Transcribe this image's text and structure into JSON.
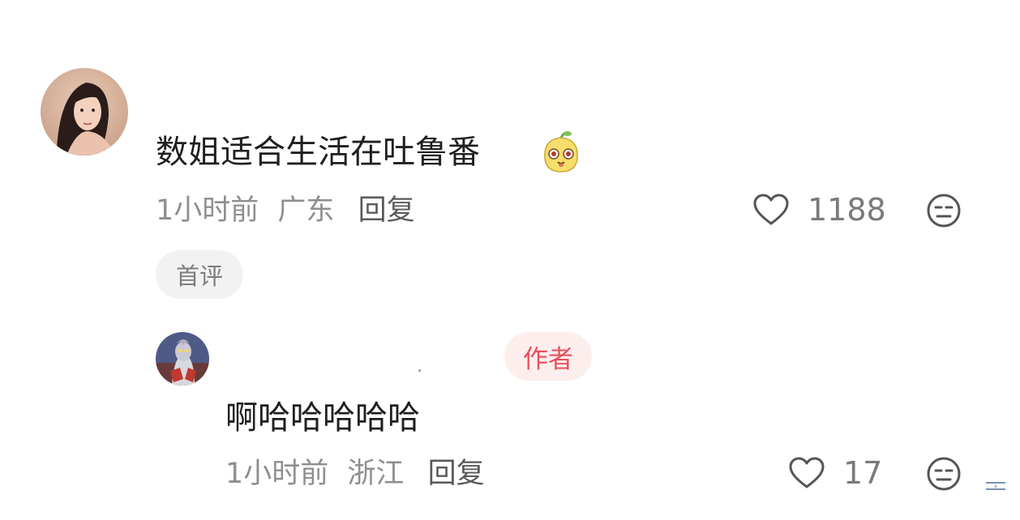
{
  "comment": {
    "text": "数姐适合生活在吐鲁番",
    "emoji_icon": "yellow-cartoon-face-icon",
    "time": "1小时前",
    "location": "广东",
    "reply_label": "回复",
    "like_count": "1188",
    "badge": "首评"
  },
  "reply": {
    "author_badge": "作者",
    "text": "啊哈哈哈哈哈",
    "time": "1小时前",
    "location": "浙江",
    "reply_label": "回复",
    "like_count": "17"
  },
  "colors": {
    "author_badge_bg": "#fdeeee",
    "author_badge_text": "#e8505b",
    "meta_text": "#8f8f8f",
    "first_badge_bg": "#f2f2f2"
  }
}
